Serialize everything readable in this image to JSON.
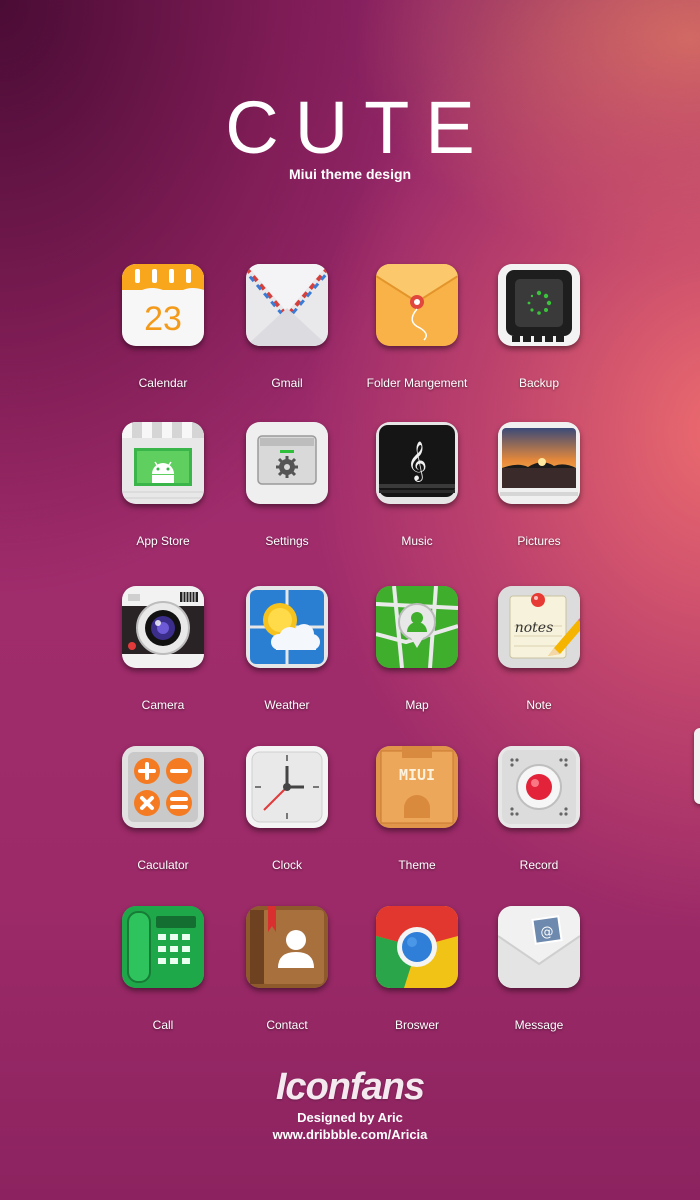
{
  "header": {
    "title": "CUTE",
    "subtitle": "Miui theme design"
  },
  "apps": [
    {
      "label": "Calendar",
      "icon": "calendar-icon",
      "date": "23"
    },
    {
      "label": "Gmail",
      "icon": "gmail-envelope-icon"
    },
    {
      "label": "Folder Mangement",
      "icon": "folder-icon"
    },
    {
      "label": "Backup",
      "icon": "backup-icon"
    },
    {
      "label": "App Store",
      "icon": "app-store-icon"
    },
    {
      "label": "Settings",
      "icon": "settings-icon"
    },
    {
      "label": "Music",
      "icon": "music-icon"
    },
    {
      "label": "Pictures",
      "icon": "pictures-icon"
    },
    {
      "label": "Camera",
      "icon": "camera-icon"
    },
    {
      "label": "Weather",
      "icon": "weather-icon"
    },
    {
      "label": "Map",
      "icon": "map-icon"
    },
    {
      "label": "Note",
      "icon": "note-icon",
      "note_text": "notes"
    },
    {
      "label": "Caculator",
      "icon": "calculator-icon"
    },
    {
      "label": "Clock",
      "icon": "clock-icon"
    },
    {
      "label": "Theme",
      "icon": "theme-icon",
      "theme_text": "MIUI"
    },
    {
      "label": "Record",
      "icon": "record-icon"
    },
    {
      "label": "Call",
      "icon": "call-icon"
    },
    {
      "label": "Contact",
      "icon": "contact-icon"
    },
    {
      "label": "Broswer",
      "icon": "browser-icon"
    },
    {
      "label": "Message",
      "icon": "message-icon"
    }
  ],
  "footer": {
    "brand": "Iconfans",
    "designer": "Designed by Aric",
    "website": "www.dribbble.com/Aricia"
  },
  "colors": {
    "background": "#9c2a68",
    "text": "#ffffff"
  }
}
